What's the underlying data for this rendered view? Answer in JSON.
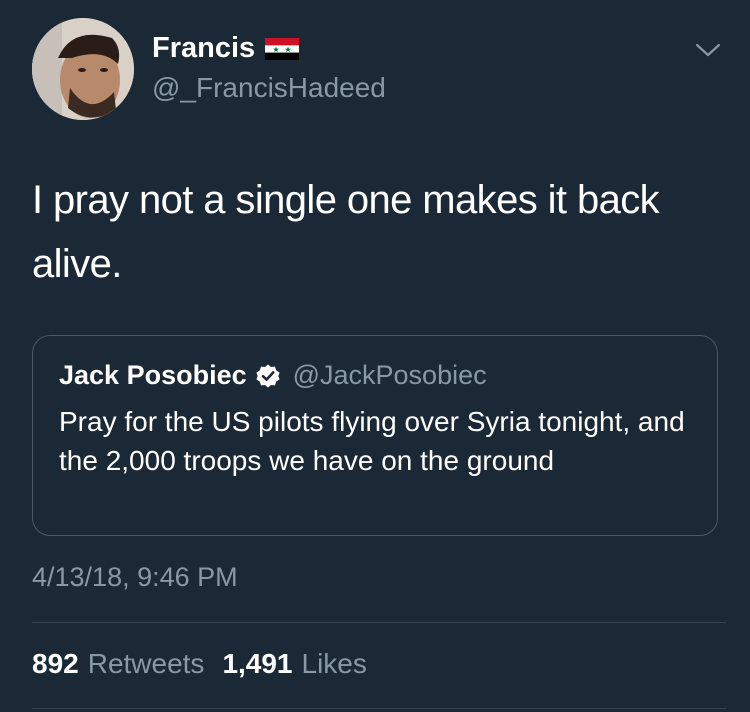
{
  "tweet": {
    "author_name": "Francis",
    "author_handle": "@_FrancisHadeed",
    "text": "I pray not a single one makes it back alive.",
    "timestamp": "4/13/18, 9:46 PM",
    "flag_icon": "syria-flag-icon",
    "menu_icon": "chevron-down-icon"
  },
  "quoted_tweet": {
    "author_name": "Jack Posobiec",
    "author_handle": "@JackPosobiec",
    "verified_icon": "verified-badge-icon",
    "text": "Pray for the US pilots flying over Syria tonight, and the 2,000 troops we have on the ground"
  },
  "stats": {
    "retweets_count": "892",
    "retweets_label": "Retweets",
    "likes_count": "1,491",
    "likes_label": "Likes"
  },
  "colors": {
    "background": "#1b2836",
    "primary_text": "#ffffff",
    "secondary_text": "#8899a6",
    "border": "#38444d"
  }
}
